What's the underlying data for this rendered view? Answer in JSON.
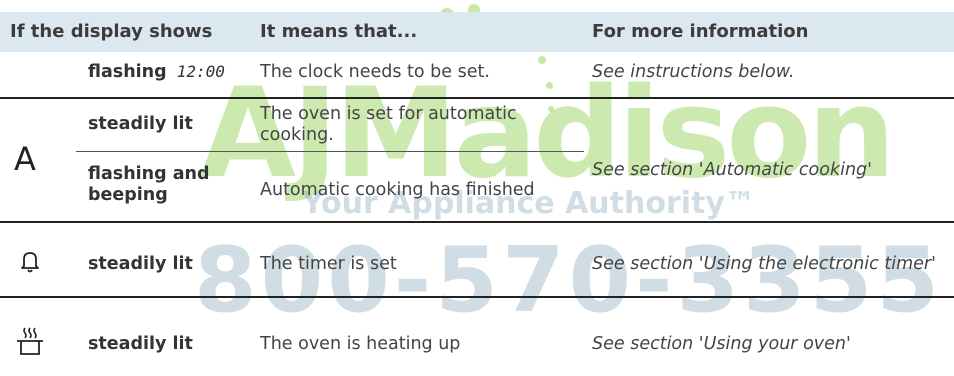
{
  "watermark": {
    "brand": "AJMadison",
    "tagline": "Your Appliance Authority™",
    "phone": "800-570-3355"
  },
  "table": {
    "headers": [
      "If the display shows",
      "It means that...",
      "For more information"
    ],
    "rows": [
      {
        "symbol": "",
        "state": "flashing",
        "clock": "12:00",
        "meaning": "The clock needs to be set.",
        "info": "See instructions below."
      },
      {
        "symbol": "A",
        "state": "steadily lit",
        "meaning": "The oven is set for automatic cooking.",
        "info": "See section 'Automatic cooking'"
      },
      {
        "symbol": "",
        "state": "flashing and beeping",
        "meaning": "Automatic cooking has finished",
        "info": ""
      },
      {
        "symbol_icon": "bell-icon",
        "state": "steadily lit",
        "meaning": "The timer is set",
        "info": "See section 'Using the electronic timer'"
      },
      {
        "symbol_icon": "oven-heating-icon",
        "state": "steadily lit",
        "meaning": "The oven is heating up",
        "info": "See section 'Using your oven'"
      }
    ]
  }
}
